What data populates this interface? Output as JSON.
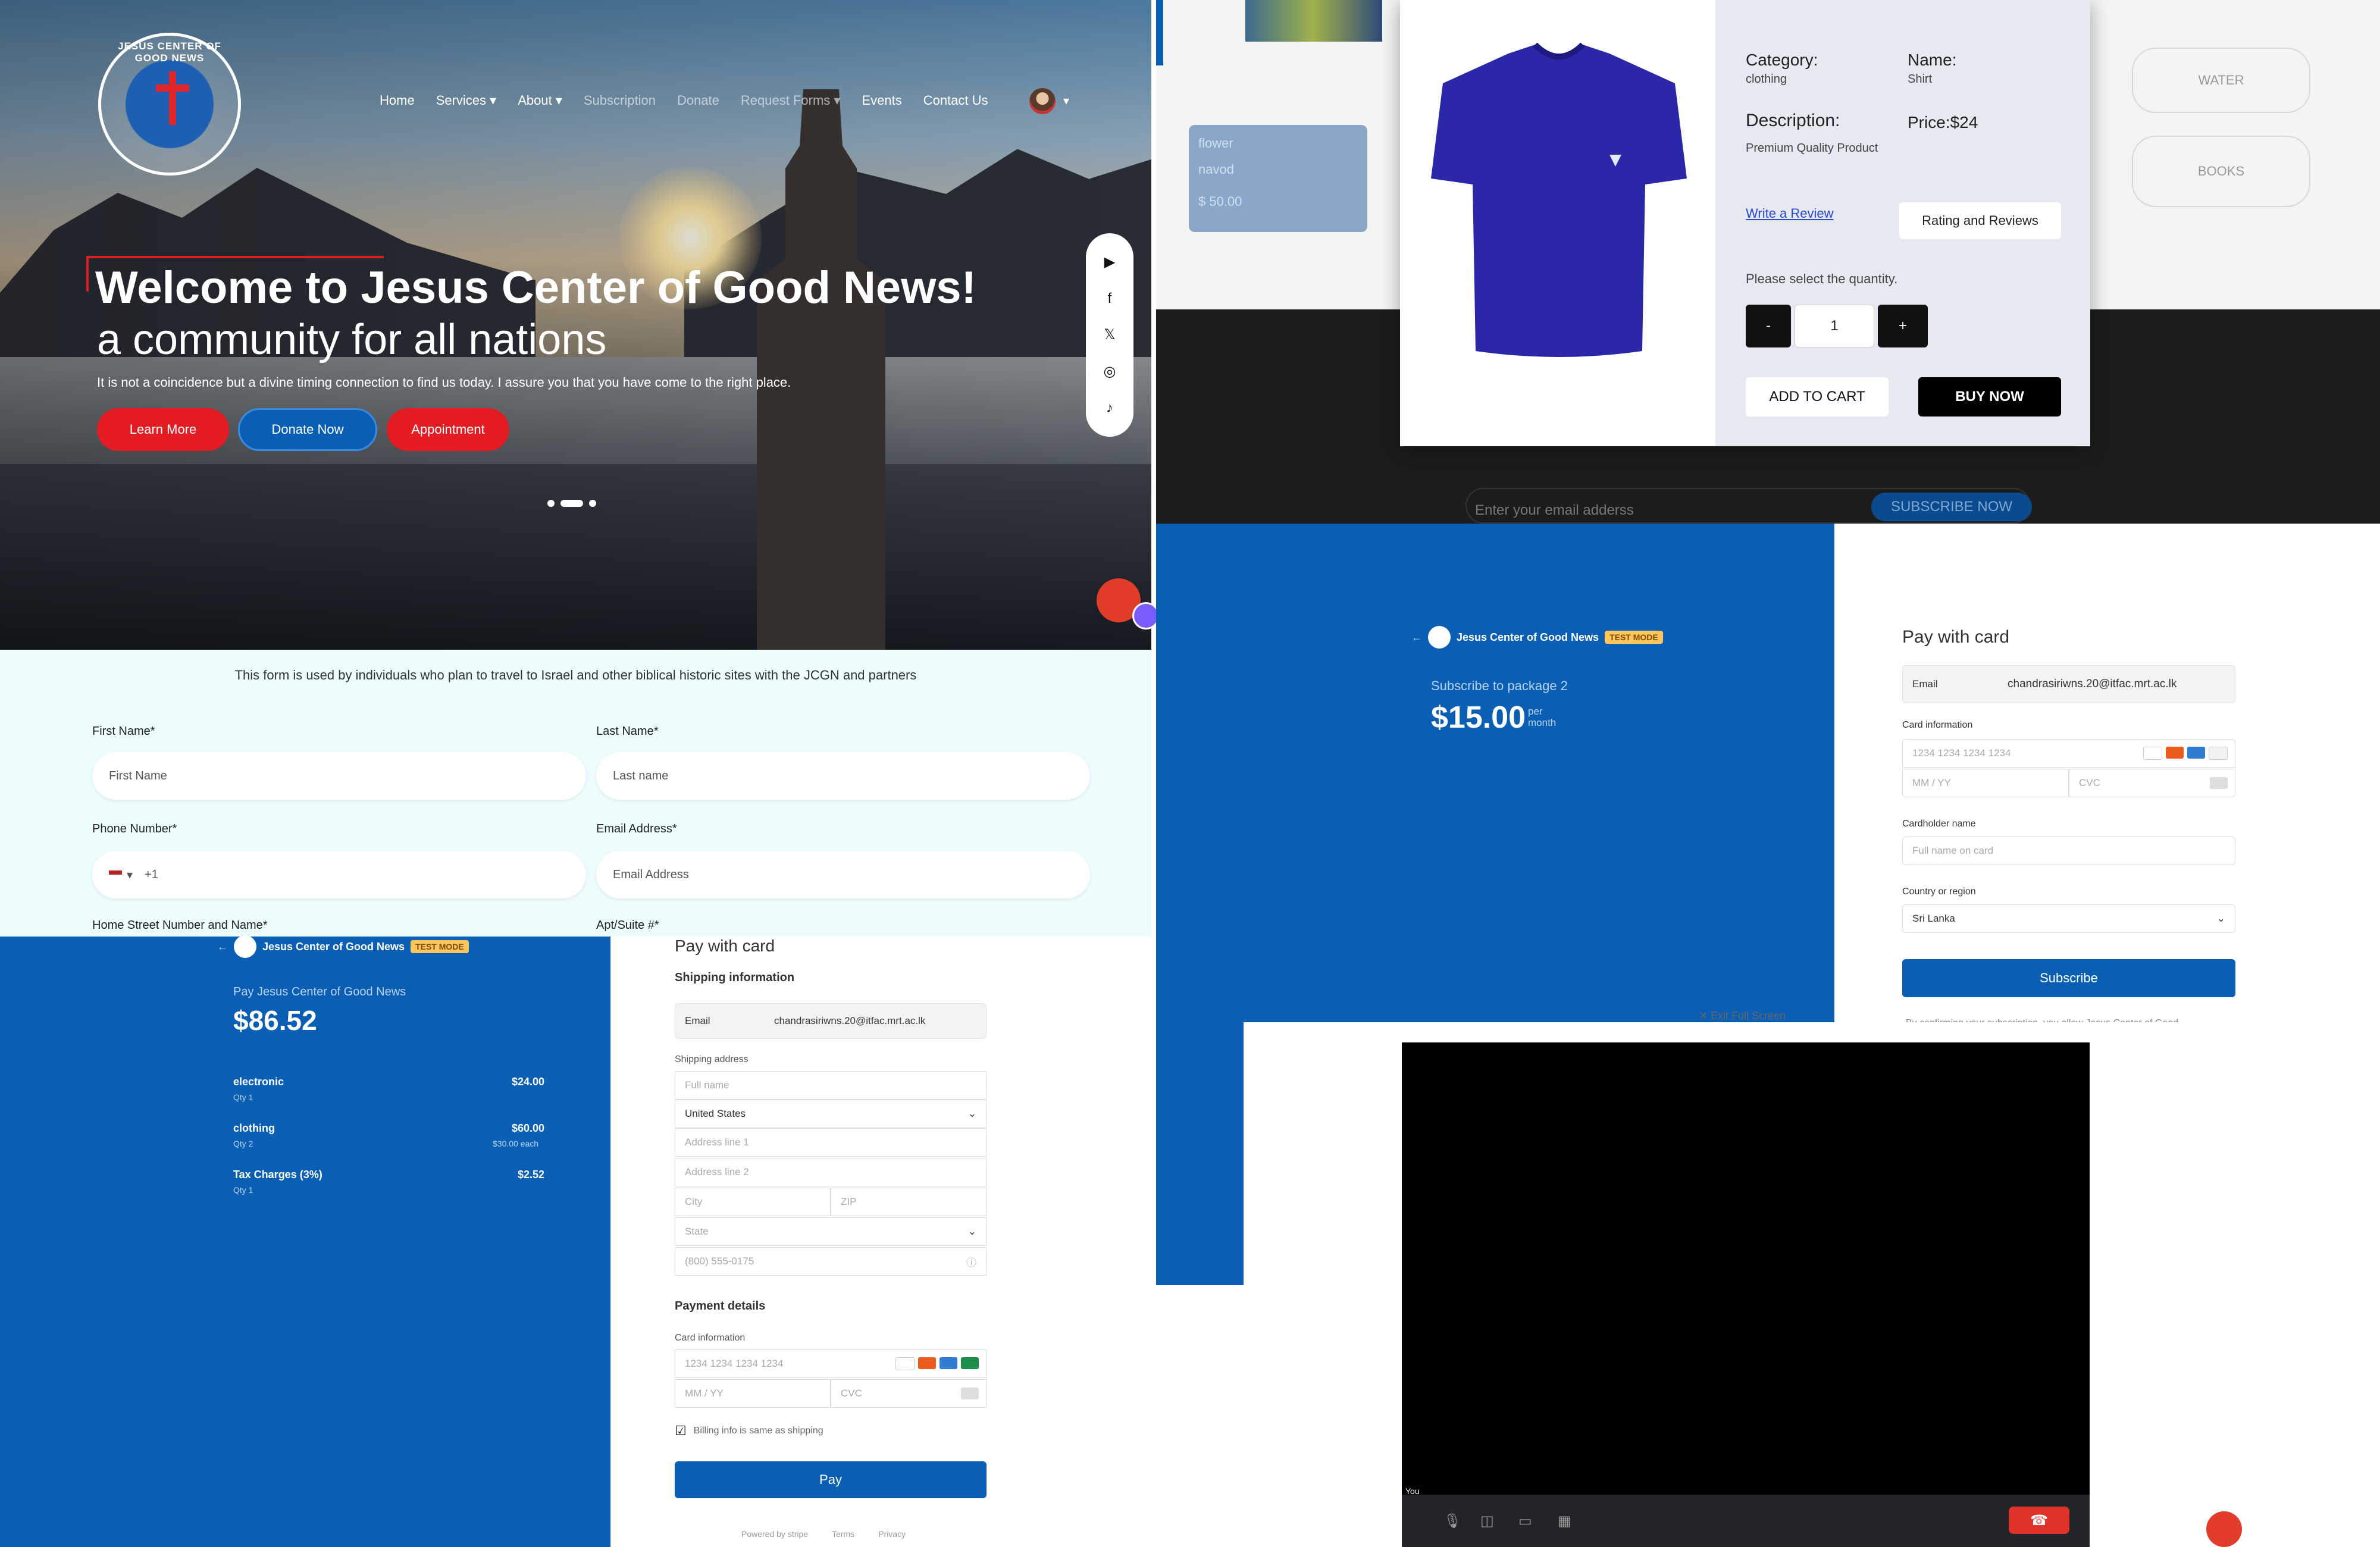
{
  "hero": {
    "logo_text": "JESUS CENTER OF GOOD NEWS",
    "nav": [
      "Home",
      "Services ▾",
      "About ▾",
      "Subscription",
      "Donate",
      "Request Forms ▾",
      "Events",
      "Contact Us"
    ],
    "avatar_caret": "▾",
    "title": "Welcome to Jesus Center of Good News!",
    "subtitle": "a community for all nations",
    "text": "It is not a coincidence but a divine timing connection to find us today. I assure you that you have come to the right place.",
    "buttons": [
      "Learn More",
      "Donate Now",
      "Appointment"
    ],
    "social_icons": [
      "youtube-icon",
      "facebook-icon",
      "x-icon",
      "instagram-icon",
      "tiktok-icon"
    ],
    "social_glyphs": [
      "▶",
      "f",
      "𝕏",
      "◎",
      "♪"
    ]
  },
  "form": {
    "note": "This form is used by individuals who plan to travel to Israel and other biblical historic sites with the JCGN and partners",
    "first_name_label": "First Name*",
    "first_name_placeholder": "First Name",
    "last_name_label": "Last Name*",
    "last_name_placeholder": "Last name",
    "phone_label": "Phone Number*",
    "phone_prefix": "+1",
    "email_label": "Email Address*",
    "email_placeholder": "Email Address",
    "street_label": "Home Street Number and Name*",
    "apt_label": "Apt/Suite #*"
  },
  "checkout": {
    "org": "Jesus Center of Good News",
    "test_mode": "TEST MODE",
    "pay_label": "Pay Jesus Center of Good News",
    "total": "$86.52",
    "items": [
      {
        "name": "electronic",
        "qty": "Qty 1",
        "price": "$24.00",
        "each": ""
      },
      {
        "name": "clothing",
        "qty": "Qty 2",
        "price": "$60.00",
        "each": "$30.00 each"
      },
      {
        "name": "Tax Charges (3%)",
        "qty": "Qty 1",
        "price": "$2.52",
        "each": ""
      }
    ],
    "pay_with_card": "Pay with card",
    "shipping_info": "Shipping information",
    "email_label": "Email",
    "email_value": "chandrasiriwns.20@itfac.mrt.ac.lk",
    "shipping_address": "Shipping address",
    "full_name": "Full name",
    "country": "United States",
    "address1": "Address line 1",
    "address2": "Address line 2",
    "city": "City",
    "zip": "ZIP",
    "state": "State",
    "phone": "(800) 555-0175",
    "payment_details": "Payment details",
    "card_info": "Card information",
    "card_number": "1234 1234 1234 1234",
    "mmyy": "MM / YY",
    "cvc": "CVC",
    "billing_same": "Billing info is same as shipping",
    "pay_button": "Pay",
    "powered_by": "Powered by stripe",
    "terms": "Terms",
    "privacy": "Privacy"
  },
  "product": {
    "bg_item_1": "flower",
    "bg_item_2": "navod",
    "bg_price": "$ 50.00",
    "bg_pill_1": "WATER",
    "bg_pill_2": "BOOKS",
    "bg_email_placeholder": "Enter your email adderss",
    "bg_subscribe": "SUBSCRIBE NOW",
    "category_label": "Category:",
    "category_value": "clothing",
    "name_label": "Name:",
    "name_value": "Shirt",
    "description_label": "Description:",
    "description_value": "Premium Quality Product",
    "price": "Price:$24",
    "write_review": "Write a Review",
    "rating_reviews": "Rating and Reviews",
    "select_quantity": "Please select the quantity.",
    "minus": "-",
    "quantity": "1",
    "plus": "+",
    "add_to_cart": "ADD TO CART",
    "buy_now": "BUY NOW"
  },
  "subscription": {
    "org": "Jesus Center of Good News",
    "test_mode": "TEST MODE",
    "package": "Subscribe to package 2",
    "price": "$15.00",
    "per": "per",
    "month": "month",
    "pay_with_card": "Pay with card",
    "email_label": "Email",
    "email_value": "chandrasiriwns.20@itfac.mrt.ac.lk",
    "card_info": "Card information",
    "card_number": "1234 1234 1234 1234",
    "mmyy": "MM / YY",
    "cvc": "CVC",
    "cardholder_label": "Cardholder name",
    "cardholder_placeholder": "Full name on card",
    "country_label": "Country or region",
    "country_value": "Sri Lanka",
    "subscribe_button": "Subscribe",
    "confirm_text": "By confirming your subscription, you allow Jesus Center of Good"
  },
  "video": {
    "exit_fullscreen": "Exit Full Screen",
    "you_label": "You"
  },
  "colors": {
    "brand_blue": "#0a5fb4",
    "hero_red": "#e31b23",
    "test_mode": "#ffc65c"
  }
}
